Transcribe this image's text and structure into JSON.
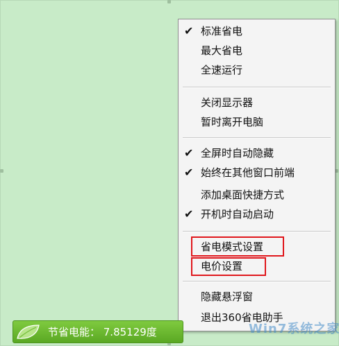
{
  "menu": {
    "groups": [
      [
        {
          "label": "标准省电",
          "checked": true
        },
        {
          "label": "最大省电",
          "checked": false
        },
        {
          "label": "全速运行",
          "checked": false
        }
      ],
      [
        {
          "label": "关闭显示器",
          "checked": false
        },
        {
          "label": "暂时离开电脑",
          "checked": false
        }
      ],
      [
        {
          "label": "全屏时自动隐藏",
          "checked": true
        },
        {
          "label": "始终在其他窗口前端",
          "checked": true
        },
        {
          "label": "添加桌面快捷方式",
          "checked": false
        },
        {
          "label": "开机时自动启动",
          "checked": true
        }
      ],
      [
        {
          "label": "省电模式设置",
          "checked": false,
          "highlighted": true
        },
        {
          "label": "电价设置",
          "checked": false,
          "highlighted": true
        }
      ],
      [
        {
          "label": "隐藏悬浮窗",
          "checked": false
        },
        {
          "label": "退出360省电助手",
          "checked": false
        }
      ]
    ],
    "check_glyph": "✔"
  },
  "status_bar": {
    "label": "节省电能： 7.85129度"
  },
  "watermark": {
    "text": "Win7系统之家"
  },
  "colors": {
    "background": "#c8ebc8",
    "menu_bg": "#f4f4f4",
    "highlight": "#e0161b",
    "status_green": "#6bb832"
  }
}
